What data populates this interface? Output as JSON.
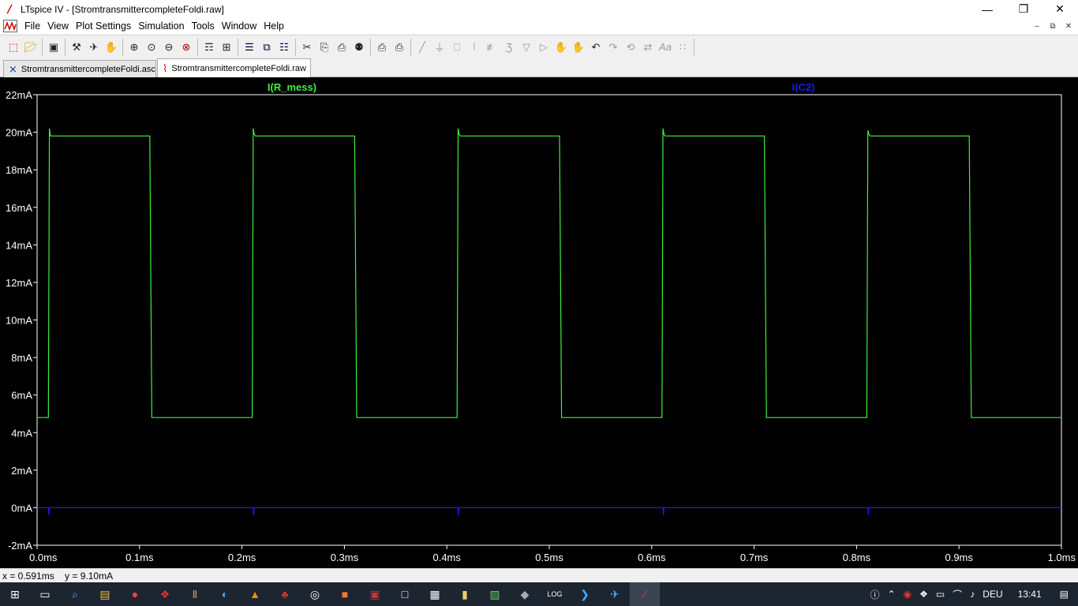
{
  "window": {
    "app_name": "LTspice IV",
    "title": "LTspice IV - [StromtransmittercompleteFoldi.raw]",
    "minimize": "—",
    "restore": "❐",
    "close": "✕"
  },
  "menu": {
    "items": [
      "File",
      "View",
      "Plot Settings",
      "Simulation",
      "Tools",
      "Window",
      "Help"
    ]
  },
  "tabs": [
    {
      "label": "StromtransmittercompleteFoldi.asc",
      "icon": "schematic-icon"
    },
    {
      "label": "StromtransmittercompleteFoldi.raw",
      "icon": "waveform-icon"
    }
  ],
  "status": {
    "cursor": "x = 0.591ms    y = 9.10mA"
  },
  "taskbar": {
    "language": "DEU",
    "time": "13:41"
  },
  "colors": {
    "plot_bg": "#000000",
    "grid": "#ffffff",
    "trace_green": "#3ef03e",
    "trace_blue": "#1a1aee"
  },
  "chart_data": {
    "type": "line",
    "title": "",
    "xlabel": "",
    "ylabel": "",
    "xlim": [
      0.0,
      1.0
    ],
    "ylim": [
      -2,
      22
    ],
    "x_unit": "ms",
    "y_unit": "mA",
    "x_tick_labels": [
      "0.0ms",
      "0.1ms",
      "0.2ms",
      "0.3ms",
      "0.4ms",
      "0.5ms",
      "0.6ms",
      "0.7ms",
      "0.8ms",
      "0.9ms",
      "1.0ms"
    ],
    "y_tick_labels": [
      "22mA",
      "20mA",
      "18mA",
      "16mA",
      "14mA",
      "12mA",
      "10mA",
      "8mA",
      "6mA",
      "4mA",
      "2mA",
      "0mA",
      "-2mA"
    ],
    "grid": false,
    "series": [
      {
        "name": "I(R_mess)",
        "color": "#3ef03e",
        "x": [
          0.0,
          0.011,
          0.012,
          0.013,
          0.11,
          0.112,
          0.21,
          0.211,
          0.212,
          0.213,
          0.31,
          0.312,
          0.41,
          0.411,
          0.412,
          0.413,
          0.51,
          0.512,
          0.61,
          0.611,
          0.612,
          0.613,
          0.71,
          0.712,
          0.81,
          0.811,
          0.812,
          0.813,
          0.91,
          0.912,
          1.0
        ],
        "y": [
          4.8,
          4.8,
          20.2,
          19.8,
          19.8,
          4.8,
          4.8,
          20.2,
          19.9,
          19.8,
          19.8,
          4.8,
          4.8,
          20.2,
          19.9,
          19.8,
          19.8,
          4.8,
          4.8,
          20.2,
          19.9,
          19.8,
          19.8,
          4.8,
          4.8,
          20.1,
          19.9,
          19.8,
          19.8,
          4.8,
          4.8
        ]
      },
      {
        "name": "I(C2)",
        "color": "#1a1aee",
        "x": [
          0.0,
          0.011,
          0.0115,
          0.012,
          0.211,
          0.2115,
          0.212,
          0.411,
          0.4115,
          0.412,
          0.611,
          0.6115,
          0.612,
          0.811,
          0.8115,
          0.812,
          1.0
        ],
        "y": [
          0.0,
          0.0,
          -0.4,
          0.0,
          0.0,
          -0.4,
          0.0,
          0.0,
          -0.4,
          0.0,
          0.0,
          -0.4,
          0.0,
          0.0,
          -0.4,
          0.0,
          0.0
        ]
      }
    ]
  }
}
